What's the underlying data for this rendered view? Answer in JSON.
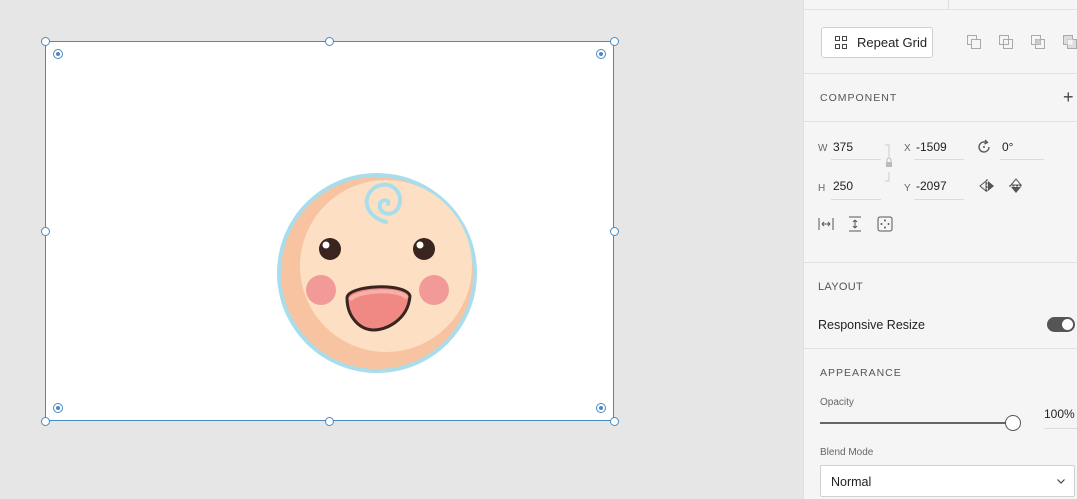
{
  "toolbar": {
    "repeat_grid_label": "Repeat Grid"
  },
  "component": {
    "title": "COMPONENT",
    "add_label": "+"
  },
  "transform": {
    "w_label": "W",
    "w_value": "375",
    "h_label": "H",
    "h_value": "250",
    "x_label": "X",
    "x_value": "-1509",
    "y_label": "Y",
    "y_value": "-2097",
    "rotation_value": "0°"
  },
  "layout": {
    "title": "LAYOUT",
    "responsive_resize_label": "Responsive Resize",
    "responsive_resize_on": true
  },
  "appearance": {
    "title": "APPEARANCE",
    "opacity_label": "Opacity",
    "opacity_value": "100%",
    "opacity_fraction": 1.0,
    "blend_mode_label": "Blend Mode",
    "blend_mode_value": "Normal"
  },
  "colors": {
    "selection": "#4a8ac4",
    "canvas": "#e6e6e6",
    "panel": "#f5f5f5"
  }
}
